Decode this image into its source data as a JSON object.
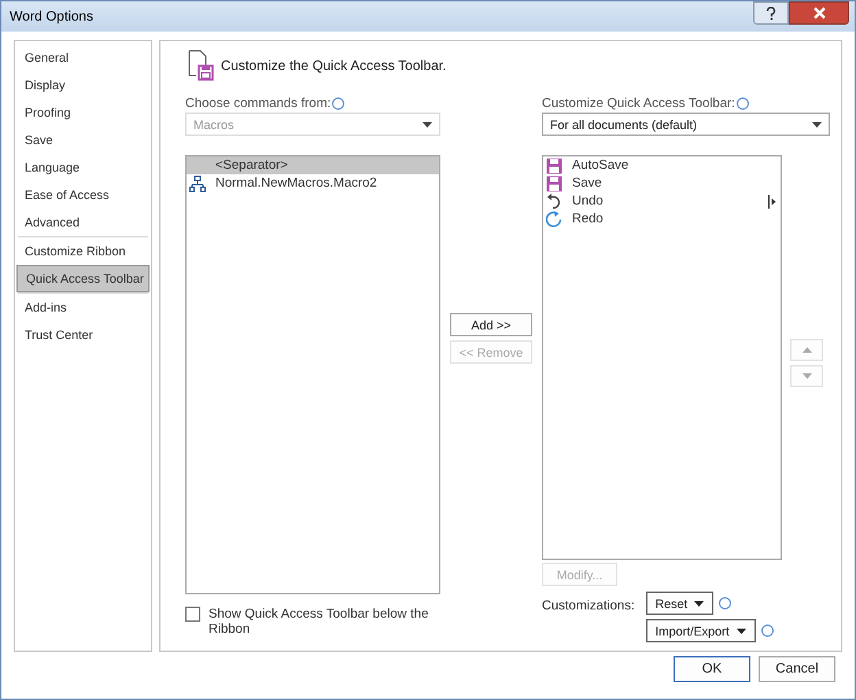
{
  "window": {
    "title": "Word Options"
  },
  "sidebar": {
    "groups": [
      {
        "items": [
          {
            "label": "General",
            "selected": false
          },
          {
            "label": "Display",
            "selected": false
          },
          {
            "label": "Proofing",
            "selected": false
          },
          {
            "label": "Save",
            "selected": false
          },
          {
            "label": "Language",
            "selected": false
          },
          {
            "label": "Ease of Access",
            "selected": false
          },
          {
            "label": "Advanced",
            "selected": false
          }
        ]
      },
      {
        "items": [
          {
            "label": "Customize Ribbon",
            "selected": false
          },
          {
            "label": "Quick Access Toolbar",
            "selected": true
          }
        ]
      },
      {
        "items": [
          {
            "label": "Add-ins",
            "selected": false
          },
          {
            "label": "Trust Center",
            "selected": false
          }
        ]
      }
    ]
  },
  "heading": "Customize the Quick Access Toolbar.",
  "commands": {
    "label": "Choose commands from:",
    "dropdown": {
      "value": "Macros",
      "disabled": true
    },
    "items": [
      {
        "kind": "separator",
        "label": "<Separator>",
        "selected": true
      },
      {
        "kind": "macro",
        "label": "Normal.NewMacros.Macro2",
        "selected": false
      }
    ]
  },
  "show_below": {
    "label": "Show Quick Access Toolbar below the Ribbon",
    "checked": false
  },
  "add_button": {
    "label": "Add >>",
    "disabled": false
  },
  "remove_button": {
    "label": "<< Remove",
    "disabled": true
  },
  "toolbar": {
    "label": "Customize Quick Access Toolbar:",
    "dropdown": {
      "value": "For all documents (default)",
      "disabled": false
    },
    "items": [
      {
        "kind": "save",
        "label": "AutoSave",
        "submenu": false
      },
      {
        "kind": "save",
        "label": "Save",
        "submenu": false
      },
      {
        "kind": "undo",
        "label": "Undo",
        "submenu": true
      },
      {
        "kind": "redo",
        "label": "Redo",
        "submenu": false
      }
    ]
  },
  "move_up": {
    "disabled": true
  },
  "move_down": {
    "disabled": true
  },
  "modify_button": {
    "label": "Modify...",
    "disabled": true
  },
  "customizations": {
    "label": "Customizations:",
    "reset": "Reset",
    "import_export": "Import/Export"
  },
  "buttons": [
    {
      "label": "OK",
      "default": true
    },
    {
      "label": "Cancel",
      "default": false
    }
  ]
}
